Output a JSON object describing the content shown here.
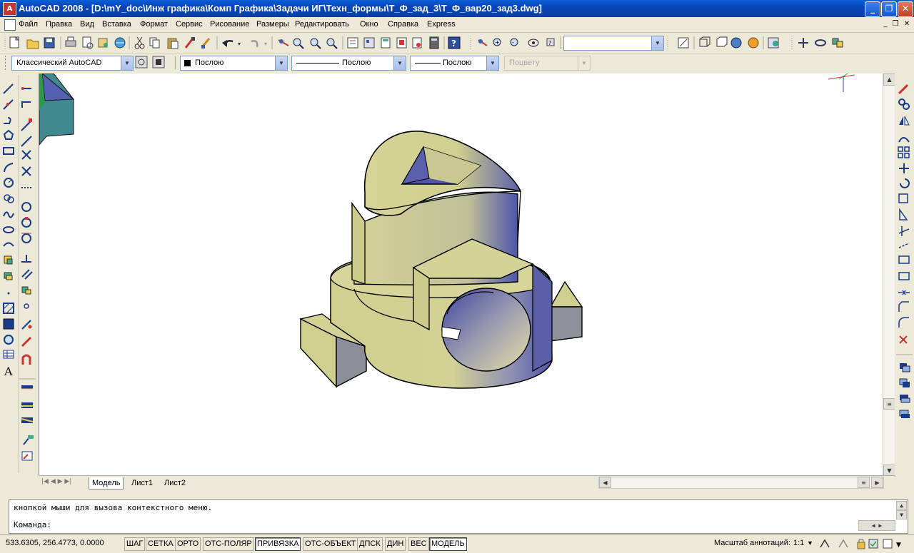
{
  "window": {
    "title": "AutoCAD 2008 - [D:\\mY_doc\\Инж графика\\Комп Графика\\Задачи ИГ\\Техн_формы\\Т_Ф_зад_3\\Т_Ф_вар20_зад3.dwg]",
    "app_icon_label": "A"
  },
  "menu": {
    "items": [
      "Файл",
      "Правка",
      "Вид",
      "Вставка",
      "Формат",
      "Сервис",
      "Рисование",
      "Размеры",
      "Редактировать",
      "Окно",
      "Справка",
      "Express"
    ]
  },
  "toolbar": {
    "workspace": "Классический AutoCAD",
    "layer": "Послою",
    "linetype": "Послою",
    "lineweight": "Послою",
    "plotstyle": "Поцвету",
    "view_combo": ""
  },
  "tabs": {
    "items": [
      "Модель",
      "Лист1",
      "Лист2"
    ],
    "active": "Модель"
  },
  "command": {
    "history": "кнопкой мыши для вызова контекстного меню.",
    "prompt": "Команда:"
  },
  "status": {
    "coords": "533.6305, 256.4773, 0.0000",
    "buttons": [
      "ШАГ",
      "СЕТКА",
      "ОРТО",
      "ОТС-ПОЛЯР",
      "ПРИВЯЗКА",
      "ОТС-ОБЪЕКТ",
      "ДПСК",
      "ДИН",
      "ВЕС",
      "МОДЕЛЬ"
    ],
    "active_buttons": [
      "ПРИВЯЗКА",
      "МОДЕЛЬ"
    ],
    "annotation_scale_label": "Масштаб аннотаций:",
    "annotation_scale_value": "1:1"
  },
  "colors": {
    "titlebar": "#0a4fc8",
    "model_face": "#cfcf8e",
    "model_shadow": "#5a5ea8",
    "model_side": "#8c8f99"
  }
}
